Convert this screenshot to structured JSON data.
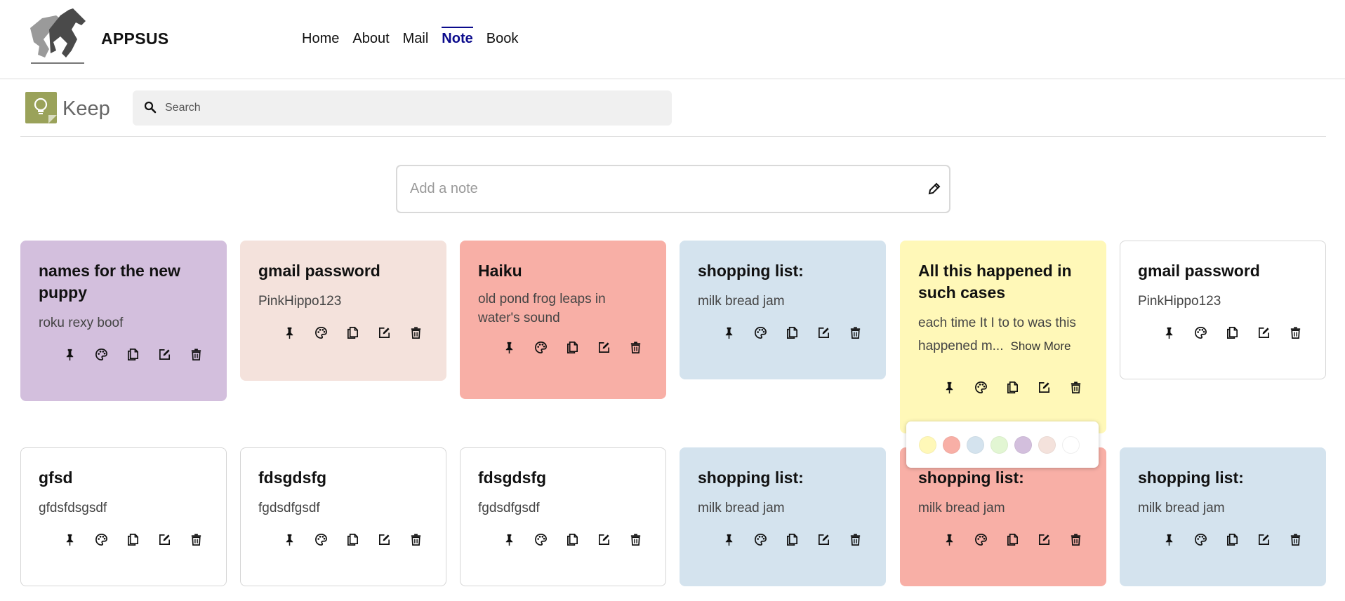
{
  "app": {
    "brand": "APPSUS",
    "nav": [
      {
        "label": "Home",
        "active": false
      },
      {
        "label": "About",
        "active": false
      },
      {
        "label": "Mail",
        "active": false
      },
      {
        "label": "Note",
        "active": true
      },
      {
        "label": "Book",
        "active": false
      }
    ]
  },
  "keep": {
    "title": "Keep",
    "search_placeholder": "Search",
    "add_note_placeholder": "Add a note",
    "search_icon": "search-icon",
    "add_note_icon": "pencil-icon"
  },
  "colors": {
    "nav_active": "#0b0b8c",
    "purple": "#d3bfdd",
    "pink": "#f4e2dc",
    "red": "#f8afa6",
    "blue": "#d4e3ee",
    "yellow": "#fff8b8",
    "white": "#ffffff"
  },
  "note_actions": [
    "pin-icon",
    "palette-icon",
    "duplicate-icon",
    "edit-icon",
    "delete-icon"
  ],
  "notes": [
    {
      "title": "names for the new puppy",
      "text": "roku rexy boof",
      "color": "#d3bfdd",
      "pinned": true
    },
    {
      "title": "gmail password",
      "text": "PinkHippo123",
      "color": "#f4e2dc",
      "pinned": false
    },
    {
      "title": "Haiku",
      "text": "old pond frog leaps in water's sound",
      "color": "#f8afa6",
      "pinned": false
    },
    {
      "title": "shopping list:",
      "text": "milk bread jam",
      "color": "#d4e3ee",
      "pinned": false
    },
    {
      "title": "All this happened in such cases",
      "text": "each time It I to to was this happened m...",
      "show_more": "Show More",
      "color": "#fff8b8",
      "pinned": false
    },
    {
      "title": "gmail password",
      "text": "PinkHippo123",
      "color": "#ffffff",
      "pinned": false
    },
    {
      "title": "gfsd",
      "text": "gfdsfdsgsdf",
      "color": "#ffffff",
      "pinned": false
    },
    {
      "title": "fdsgdsfg",
      "text": "fgdsdfgsdf",
      "color": "#ffffff",
      "pinned": false
    },
    {
      "title": "fdsgdsfg",
      "text": "fgdsdfgsdf",
      "color": "#ffffff",
      "pinned": false
    },
    {
      "title": "shopping list:",
      "text": "milk bread jam",
      "color": "#d4e3ee",
      "pinned": false
    },
    {
      "title": "shopping list:",
      "text": "milk bread jam",
      "color": "#f8afa6",
      "pinned": false
    },
    {
      "title": "shopping list:",
      "text": "milk bread jam",
      "color": "#d4e3ee",
      "pinned": false
    }
  ],
  "palette_colors": [
    "#fff8b8",
    "#f8afa6",
    "#d4e3ee",
    "#e2f6d3",
    "#d3bfdd",
    "#f4e2dc",
    "#ffffff"
  ]
}
